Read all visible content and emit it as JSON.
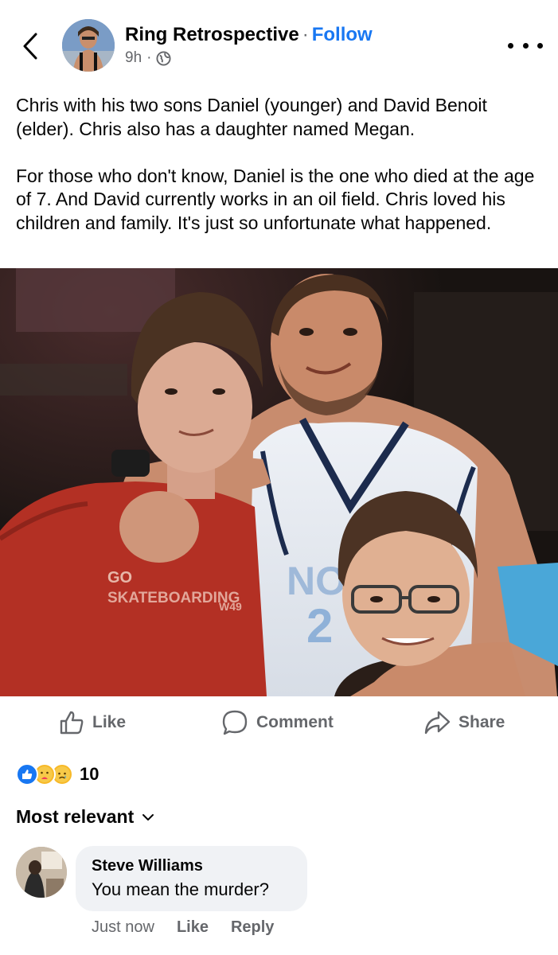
{
  "header": {
    "page_name": "Ring Retrospective",
    "separator": "·",
    "follow_label": "Follow",
    "timestamp": "9h",
    "meta_separator": "·",
    "audience_icon": "globe-icon",
    "back_icon": "chevron-left-icon",
    "more_icon": "more-dots-icon"
  },
  "post": {
    "paragraphs": [
      "Chris with his two sons Daniel (younger) and David Benoit (elder). Chris also has a daughter named Megan.",
      "For those who don't know, Daniel is the one who died at the age of 7. And David currently works in an oil field. Chris loved his children and family. It's just so unfortunate what happened."
    ],
    "photo": {
      "shirt_text_1": "GO",
      "shirt_text_2": "SKATEBOARDING",
      "shirt_text_3": "W49",
      "jersey_text_1": "NO",
      "jersey_text_2": "2"
    }
  },
  "actions": {
    "like_label": "Like",
    "comment_label": "Comment",
    "share_label": "Share"
  },
  "reactions": {
    "icons": [
      "like-reaction-icon",
      "care-reaction-icon",
      "sad-reaction-icon"
    ],
    "count": "10"
  },
  "comments": {
    "sort_label": "Most relevant",
    "items": [
      {
        "author": "Steve Williams",
        "text": "You mean the murder?",
        "time": "Just now",
        "like_label": "Like",
        "reply_label": "Reply"
      }
    ]
  },
  "colors": {
    "accent": "#1877f2",
    "secondary_text": "#65676b",
    "bubble_bg": "#f0f2f5"
  }
}
